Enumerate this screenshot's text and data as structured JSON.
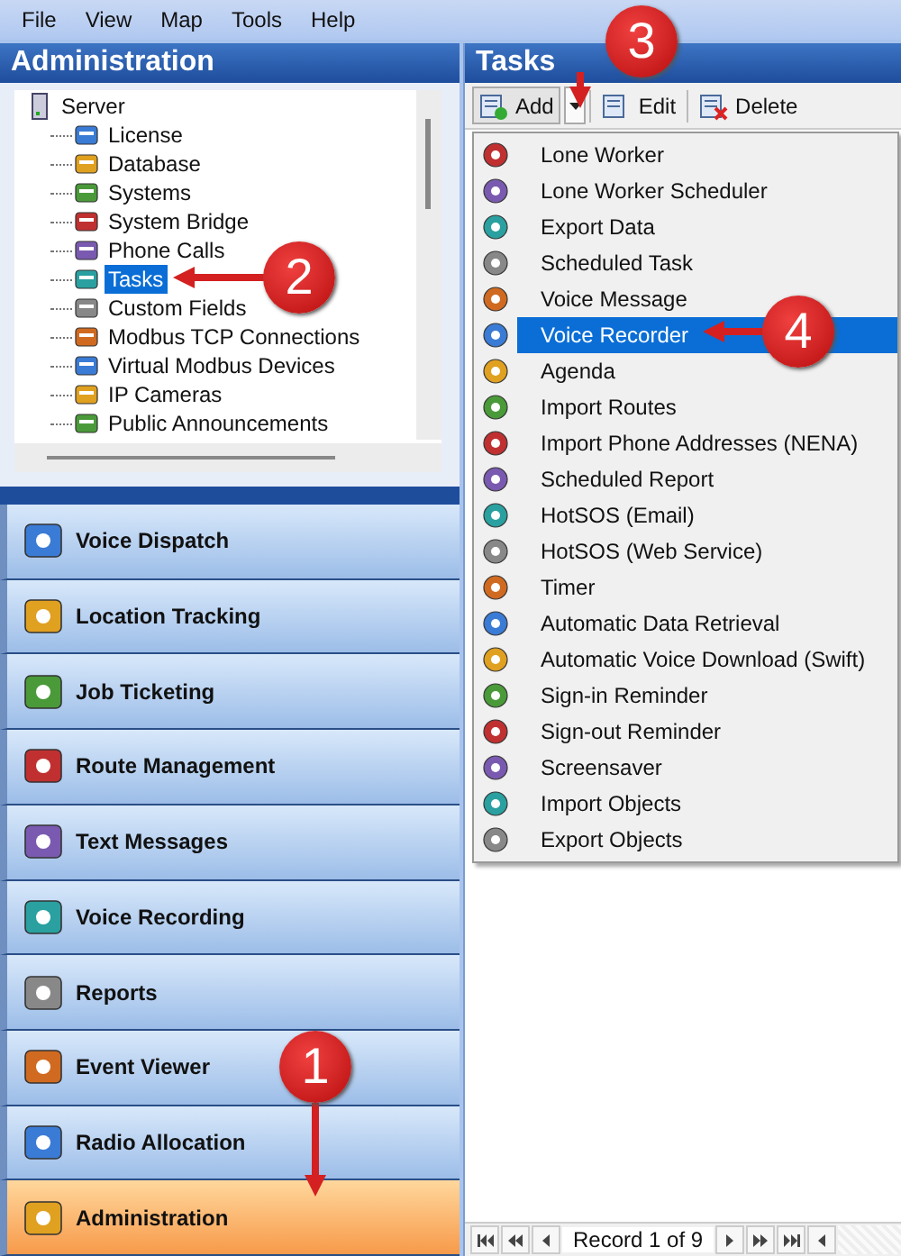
{
  "menu": [
    {
      "label": "File"
    },
    {
      "label": "View"
    },
    {
      "label": "Map"
    },
    {
      "label": "Tools"
    },
    {
      "label": "Help"
    }
  ],
  "admin_panel": {
    "title": "Administration",
    "tree": {
      "label": "Server",
      "selected": false,
      "children": [
        {
          "label": "License",
          "selected": false
        },
        {
          "label": "Database",
          "selected": false
        },
        {
          "label": "Systems",
          "selected": false
        },
        {
          "label": "System Bridge",
          "selected": false
        },
        {
          "label": "Phone Calls",
          "selected": false
        },
        {
          "label": "Tasks",
          "selected": true
        },
        {
          "label": "Custom Fields",
          "selected": false
        },
        {
          "label": "Modbus TCP Connections",
          "selected": false
        },
        {
          "label": "Virtual Modbus Devices",
          "selected": false
        },
        {
          "label": "IP Cameras",
          "selected": false
        },
        {
          "label": "Public Announcements",
          "selected": false
        }
      ]
    }
  },
  "nav_buttons": [
    {
      "label": "Voice Dispatch",
      "selected": false
    },
    {
      "label": "Location Tracking",
      "selected": false
    },
    {
      "label": "Job Ticketing",
      "selected": false
    },
    {
      "label": "Route Management",
      "selected": false
    },
    {
      "label": "Text Messages",
      "selected": false
    },
    {
      "label": "Voice Recording",
      "selected": false
    },
    {
      "label": "Reports",
      "selected": false
    },
    {
      "label": "Event Viewer",
      "selected": false
    },
    {
      "label": "Radio Allocation",
      "selected": false
    },
    {
      "label": "Administration",
      "selected": true
    }
  ],
  "tasks_panel": {
    "title": "Tasks",
    "toolbar": [
      {
        "label": "Add"
      },
      {
        "label": "Edit"
      },
      {
        "label": "Delete"
      }
    ],
    "add_menu": [
      {
        "label": "Lone Worker",
        "selected": false
      },
      {
        "label": "Lone Worker Scheduler",
        "selected": false
      },
      {
        "label": "Export Data",
        "selected": false
      },
      {
        "label": "Scheduled Task",
        "selected": false
      },
      {
        "label": "Voice Message",
        "selected": false
      },
      {
        "label": "Voice Recorder",
        "selected": true
      },
      {
        "label": "Agenda",
        "selected": false
      },
      {
        "label": "Import Routes",
        "selected": false
      },
      {
        "label": "Import Phone Addresses (NENA)",
        "selected": false
      },
      {
        "label": "Scheduled Report",
        "selected": false
      },
      {
        "label": "HotSOS (Email)",
        "selected": false
      },
      {
        "label": "HotSOS (Web Service)",
        "selected": false
      },
      {
        "label": "Timer",
        "selected": false
      },
      {
        "label": "Automatic Data Retrieval",
        "selected": false
      },
      {
        "label": "Automatic Voice Download (Swift)",
        "selected": false
      },
      {
        "label": "Sign-in Reminder",
        "selected": false
      },
      {
        "label": "Sign-out Reminder",
        "selected": false
      },
      {
        "label": "Screensaver",
        "selected": false
      },
      {
        "label": "Import Objects",
        "selected": false
      },
      {
        "label": "Export Objects",
        "selected": false
      }
    ],
    "record_navigator": {
      "text": "Record 1 of 9"
    }
  },
  "callouts": [
    {
      "label": "1"
    },
    {
      "label": "2"
    },
    {
      "label": "3"
    },
    {
      "label": "4"
    }
  ]
}
